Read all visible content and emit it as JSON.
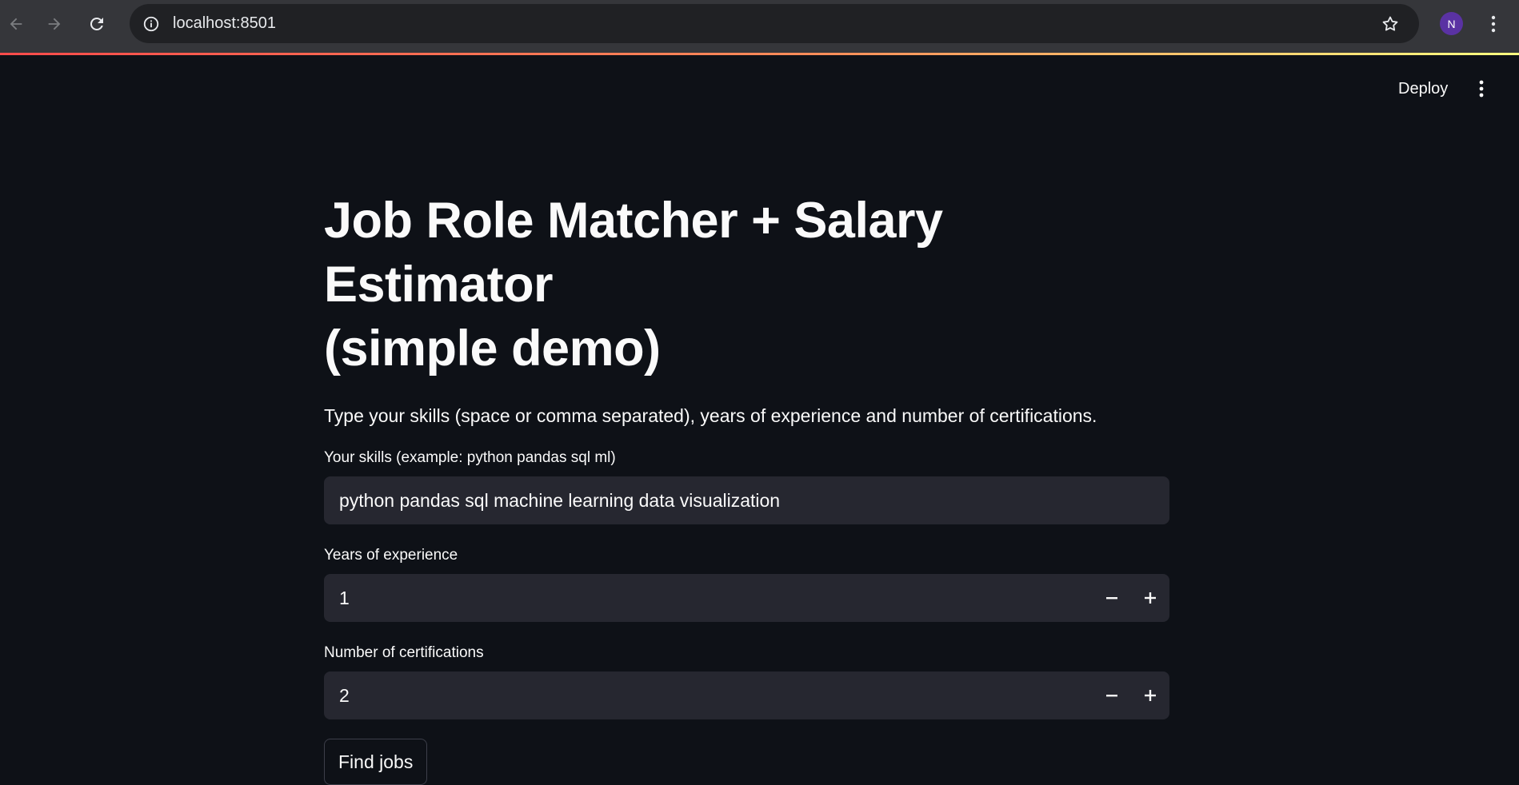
{
  "browser": {
    "url": "localhost:8501",
    "profile_initial": "N",
    "icons": [
      "back-arrow-icon",
      "forward-arrow-icon",
      "reload-icon",
      "info-icon",
      "star-icon",
      "kebab-menu-icon"
    ]
  },
  "header": {
    "deploy_label": "Deploy"
  },
  "main": {
    "title_line1": "Job Role Matcher + Salary Estimator",
    "title_line2": "(simple demo)",
    "intro": "Type your skills (space or comma separated), years of experience and number of certifications.",
    "skills": {
      "label": "Your skills (example: python pandas sql ml)",
      "value": "python pandas sql machine learning data visualization"
    },
    "years": {
      "label": "Years of experience",
      "value": "1"
    },
    "certifications": {
      "label": "Number of certifications",
      "value": "2"
    },
    "submit_label": "Find jobs"
  },
  "colors": {
    "background": "#0e1117",
    "input_background": "#262730",
    "text": "#fafafa",
    "accent": "#ff4b4b",
    "avatar": "#5a32a3"
  }
}
